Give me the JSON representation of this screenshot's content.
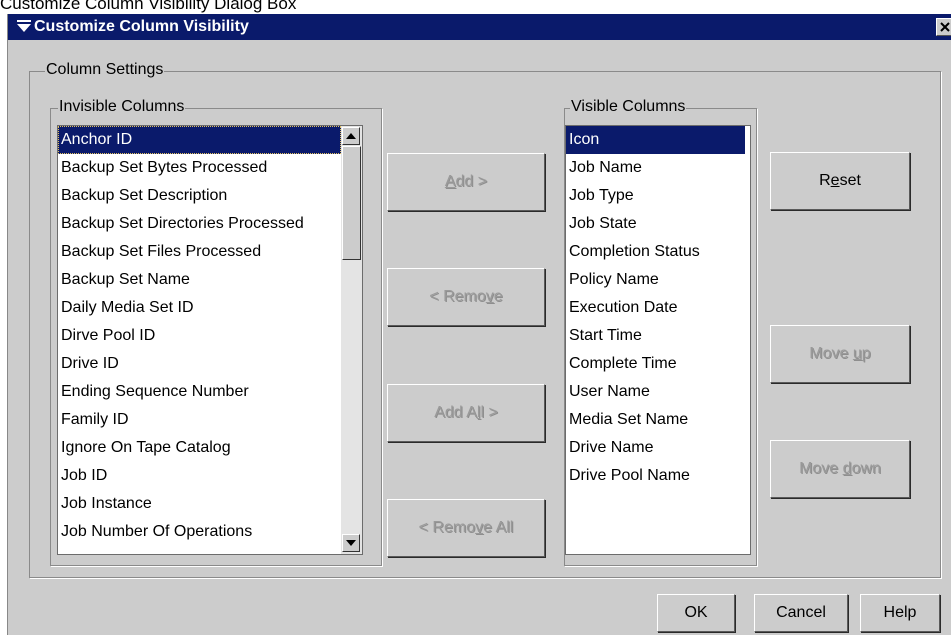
{
  "caption": "Customize Column Visibility Dialog Box",
  "window": {
    "title": "Customize Column Visibility"
  },
  "column_settings": {
    "label": "Column Settings",
    "invisible": {
      "label": "Invisible Columns",
      "items": [
        "Anchor ID",
        "Backup Set Bytes Processed",
        "Backup Set Description",
        "Backup Set Directories Processed",
        "Backup Set Files Processed",
        "Backup Set Name",
        "Daily Media Set ID",
        "Dirve Pool ID",
        "Drive ID",
        "Ending Sequence Number",
        "Family ID",
        "Ignore On Tape Catalog",
        "Job ID",
        "Job Instance",
        "Job Number Of Operations"
      ],
      "selected": "Anchor ID"
    },
    "visible": {
      "label": "Visible Columns",
      "items": [
        "Icon",
        "Job Name",
        "Job Type",
        "Job State",
        "Completion Status",
        "Policy Name",
        "Execution Date",
        "Start Time",
        "Complete Time",
        "User Name",
        "Media Set Name",
        "Drive Name",
        "Drive Pool Name"
      ],
      "selected": "Icon"
    },
    "buttons": {
      "add": {
        "pre": "",
        "key": "A",
        "post": "dd >"
      },
      "remove": {
        "pre": "< Remo",
        "key": "v",
        "post": "e"
      },
      "add_all": {
        "pre": "Add A",
        "key": "l",
        "post": "l >"
      },
      "remove_all": {
        "pre": "< Remo",
        "key": "v",
        "post": "e All"
      },
      "reset": {
        "pre": "R",
        "key": "e",
        "post": "set"
      },
      "move_up": {
        "pre": "Move ",
        "key": "u",
        "post": "p"
      },
      "move_down": {
        "pre": "Move ",
        "key": "d",
        "post": "own"
      }
    }
  },
  "footer": {
    "ok": "OK",
    "cancel": "Cancel",
    "help": "Help"
  },
  "icons": {
    "window_menu": "down-triangle-menu-icon",
    "close": "close-icon",
    "scroll_up": "arrow-up-icon",
    "scroll_down": "arrow-down-icon"
  }
}
